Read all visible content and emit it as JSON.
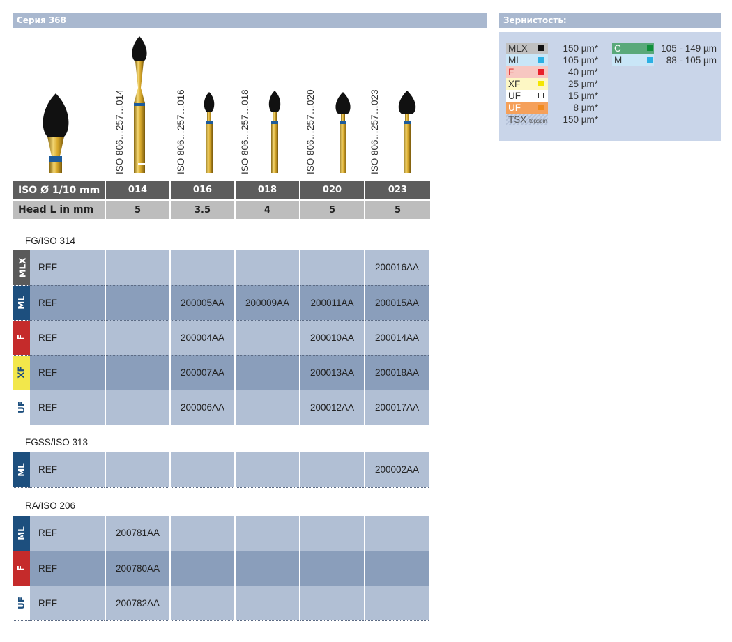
{
  "header": {
    "series": "Серия 368",
    "grit_title": "Зернистость:"
  },
  "grit": {
    "left": [
      {
        "code": "MLX",
        "size": "150 µm*",
        "bg": "#c0c0c0",
        "sq": "#111111"
      },
      {
        "code": "ML",
        "size": "105 µm*",
        "bg": "#c9e6f7",
        "sq": "#2ab0e4"
      },
      {
        "code": "F",
        "size": "40 µm*",
        "bg": "#f7c7c1",
        "sq": "#e8202a"
      },
      {
        "code": "XF",
        "size": "25 µm*",
        "bg": "#fdf7c4",
        "sq": "#f4e600"
      },
      {
        "code": "UF",
        "size": "15 µm*",
        "bg": "#ffffff",
        "sq": "#ffffff"
      },
      {
        "code": "UF",
        "size": "8 µm*",
        "bg": "#f5a05a",
        "sq": "#f08a1e"
      },
      {
        "code": "TSX",
        "topspin": "topspin",
        "size": "150 µm*",
        "bg": "",
        "sq": ""
      }
    ],
    "right": [
      {
        "code": "C",
        "size": "105 - 149 µm",
        "bg": "#5aa97a",
        "sq": "#0f8f3a"
      },
      {
        "code": "M",
        "size": "88 - 105 µm",
        "bg": "#c9e6f7",
        "sq": "#2ab0e4"
      }
    ]
  },
  "iso_labels": [
    "ISO 806…257…014",
    "ISO 806…257…016",
    "ISO 806…257…018",
    "ISO 806…257…020",
    "ISO 806…257…023"
  ],
  "spec": {
    "row1_label": "ISO Ø 1/10 mm",
    "row2_label": "Head L in mm",
    "sizes": [
      "014",
      "016",
      "018",
      "020",
      "023"
    ],
    "head_lengths": [
      "5",
      "3.5",
      "4",
      "5",
      "5"
    ]
  },
  "sections": [
    {
      "title": "FG/ISO 314",
      "rows": [
        {
          "code": "MLX",
          "ref": "REF",
          "cells": [
            "",
            "",
            "",
            "",
            "200016AA"
          ]
        },
        {
          "code": "ML",
          "ref": "REF",
          "cells": [
            "",
            "200005AA",
            "200009AA",
            "200011AA",
            "200015AA"
          ]
        },
        {
          "code": "F",
          "ref": "REF",
          "cells": [
            "",
            "200004AA",
            "",
            "200010AA",
            "200014AA"
          ]
        },
        {
          "code": "XF",
          "ref": "REF",
          "cells": [
            "",
            "200007AA",
            "",
            "200013AA",
            "200018AA"
          ]
        },
        {
          "code": "UF",
          "ref": "REF",
          "cells": [
            "",
            "200006AA",
            "",
            "200012AA",
            "200017AA"
          ]
        }
      ]
    },
    {
      "title": "FGSS/ISO 313",
      "rows": [
        {
          "code": "ML",
          "ref": "REF",
          "cells": [
            "",
            "",
            "",
            "",
            "200002AA"
          ]
        }
      ]
    },
    {
      "title": "RA/ISO 206",
      "rows": [
        {
          "code": "ML",
          "ref": "REF",
          "cells": [
            "200781AA",
            "",
            "",
            "",
            ""
          ]
        },
        {
          "code": "F",
          "ref": "REF",
          "cells": [
            "200780AA",
            "",
            "",
            "",
            ""
          ]
        },
        {
          "code": "UF",
          "ref": "REF",
          "cells": [
            "200782AA",
            "",
            "",
            "",
            ""
          ]
        }
      ]
    }
  ]
}
